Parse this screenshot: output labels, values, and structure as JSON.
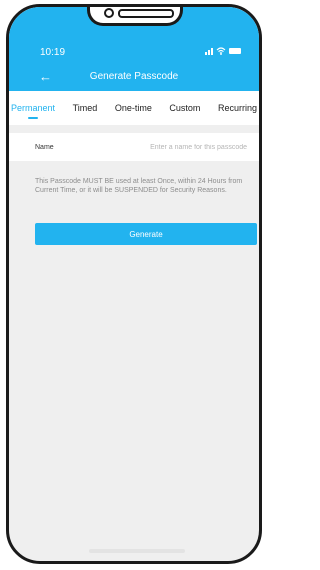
{
  "status_bar": {
    "time": "10:19",
    "icons": [
      "signal-icon",
      "wifi-icon",
      "battery-icon"
    ]
  },
  "header": {
    "title": "Generate Passcode",
    "back_icon": "arrow-left-icon"
  },
  "tabs": [
    {
      "label": "Permanent",
      "active": true
    },
    {
      "label": "Timed",
      "active": false
    },
    {
      "label": "One-time",
      "active": false
    },
    {
      "label": "Custom",
      "active": false
    },
    {
      "label": "Recurring",
      "active": false
    }
  ],
  "form": {
    "name_label": "Name",
    "name_placeholder": "Enter a name for this passcode",
    "name_value": ""
  },
  "notice": "This Passcode MUST BE used at least Once, within 24 Hours from Current Time, or it will be SUSPENDED for Security Reasons.",
  "generate_label": "Generate",
  "colors": {
    "accent": "#22b3ef",
    "background": "#efefef",
    "text_muted": "#8d8d8d"
  }
}
